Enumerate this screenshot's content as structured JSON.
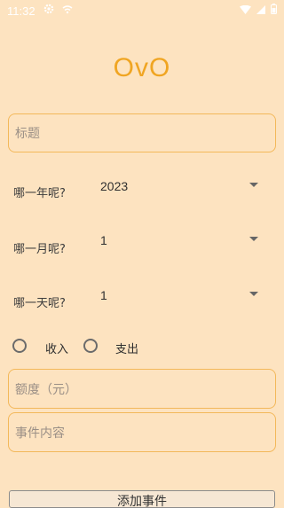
{
  "status_bar": {
    "time": "11:32",
    "icons": [
      "settings-gear-icon",
      "wifi-indicator-icon",
      "wifi-signal-icon",
      "cell-signal-icon",
      "battery-icon"
    ]
  },
  "app": {
    "title": "OvO"
  },
  "form": {
    "title_placeholder": "标题",
    "year": {
      "label": "哪一年呢?",
      "value": "2023"
    },
    "month": {
      "label": "哪一月呢?",
      "value": "1"
    },
    "day": {
      "label": "哪一天呢?",
      "value": "1"
    },
    "type_options": [
      {
        "label": "收入"
      },
      {
        "label": "支出"
      }
    ],
    "amount_placeholder": "额度（元）",
    "content_placeholder": "事件内容",
    "submit_label": "添加事件"
  },
  "colors": {
    "background": "#FDE3C0",
    "accent": "#F0A522",
    "field_border": "#F3B85A"
  }
}
